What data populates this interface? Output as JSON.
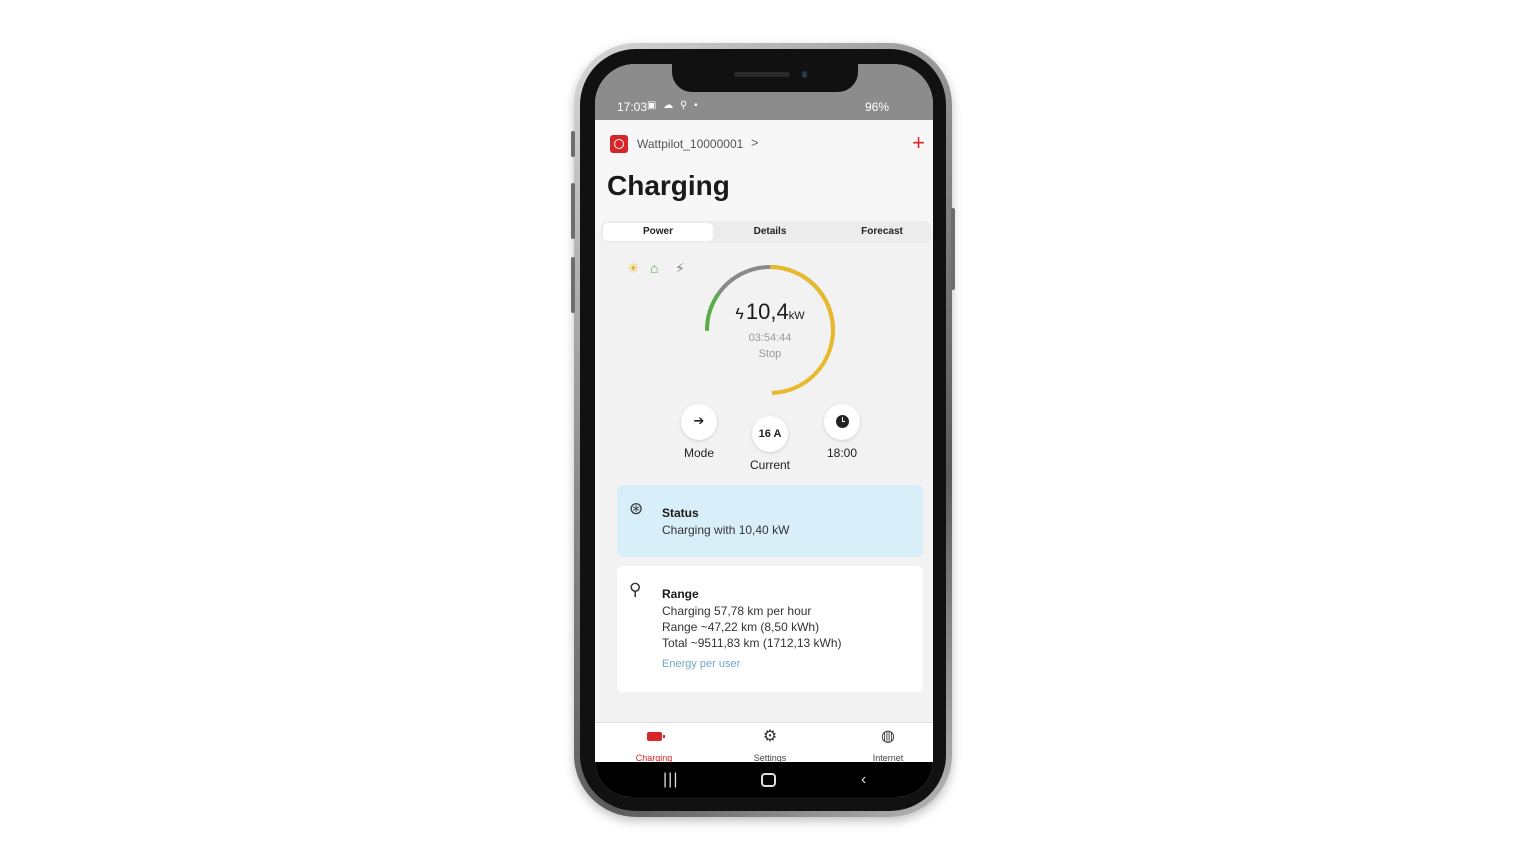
{
  "status_bar": {
    "time": "17:03",
    "left_icons": "▣ ☁ ⚲ •",
    "right_text": "96%"
  },
  "header": {
    "device_name": "Wattpilot_10000001",
    "chevron": ">",
    "plus": "+",
    "title": "Charging"
  },
  "tabs": [
    {
      "label": "Power",
      "active": true
    },
    {
      "label": "Details",
      "active": false
    },
    {
      "label": "Forecast",
      "active": false
    }
  ],
  "sources": {
    "sun_icon": "☀",
    "home_icon": "⌂",
    "grid_icon": "⚡"
  },
  "ring": {
    "power_value": "10,4",
    "power_unit": "kW",
    "bolt": "ϟ",
    "elapsed": "03:54:44",
    "stop_label": "Stop",
    "colors": {
      "solar": "#e8b92b",
      "home": "#5aac4b",
      "grid": "#8a8a8a"
    }
  },
  "controls": {
    "mode_label": "Mode",
    "current_value": "16 A",
    "current_label": "Current",
    "time_label": "18:00",
    "plug_glyph": "➔"
  },
  "status_card": {
    "icon": "⊛",
    "title": "Status",
    "text": "Charging with 10,40 kW"
  },
  "range_card": {
    "icon": "⚲",
    "title": "Range",
    "lines": [
      "Charging 57,78 km per hour",
      "Range ~47,22 km (8,50 kWh)",
      "Total ~9511,83 km (1712,13 kWh)"
    ],
    "link": "Energy per user"
  },
  "bottom_nav": [
    {
      "label": "Charging",
      "icon": "battery-icon",
      "active": true
    },
    {
      "label": "Settings",
      "icon": "gear-icon",
      "glyph": "⚙",
      "active": false
    },
    {
      "label": "Internet",
      "icon": "globe-icon",
      "glyph": "◍",
      "active": false
    }
  ],
  "android_nav": {
    "recents": "|||",
    "back": "‹"
  }
}
